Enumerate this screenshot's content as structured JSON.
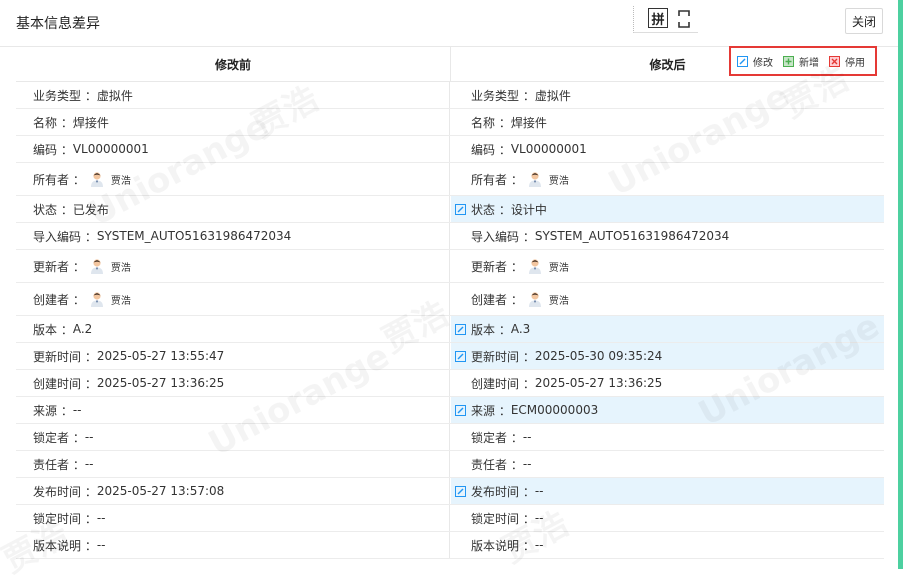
{
  "header": {
    "title": "基本信息差异",
    "pin_label": "拼",
    "close_label": "关闭"
  },
  "columns": {
    "before": "修改前",
    "after": "修改后"
  },
  "legend": [
    {
      "label": "修改",
      "color": "#2196f3"
    },
    {
      "label": "新增",
      "color": "#4caf50"
    },
    {
      "label": "停用",
      "color": "#e53935"
    }
  ],
  "watermark": {
    "brand": "Uniorange",
    "name": "贾浩"
  },
  "rows": [
    {
      "label": "业务类型",
      "before": "虚拟件",
      "after": "虚拟件",
      "changed": false
    },
    {
      "label": "名称",
      "before": "焊接件",
      "after": "焊接件",
      "changed": false
    },
    {
      "label": "编码",
      "before": "VL00000001",
      "after": "VL00000001",
      "changed": false
    },
    {
      "label": "所有者",
      "before_user": "贾浩",
      "after_user": "贾浩",
      "changed": false,
      "user": true
    },
    {
      "label": "状态",
      "before": "已发布",
      "after": "设计中",
      "changed": true
    },
    {
      "label": "导入编码",
      "before": "SYSTEM_AUTO51631986472034",
      "after": "SYSTEM_AUTO51631986472034",
      "changed": false
    },
    {
      "label": "更新者",
      "before_user": "贾浩",
      "after_user": "贾浩",
      "changed": false,
      "user": true
    },
    {
      "label": "创建者",
      "before_user": "贾浩",
      "after_user": "贾浩",
      "changed": false,
      "user": true
    },
    {
      "label": "版本",
      "before": "A.2",
      "after": "A.3",
      "changed": true
    },
    {
      "label": "更新时间",
      "before": "2025-05-27 13:55:47",
      "after": "2025-05-30 09:35:24",
      "changed": true
    },
    {
      "label": "创建时间",
      "before": "2025-05-27 13:36:25",
      "after": "2025-05-27 13:36:25",
      "changed": false
    },
    {
      "label": "来源",
      "before": "--",
      "after": "ECM00000003",
      "changed": true
    },
    {
      "label": "锁定者",
      "before": "--",
      "after": "--",
      "changed": false
    },
    {
      "label": "责任者",
      "before": "--",
      "after": "--",
      "changed": false
    },
    {
      "label": "发布时间",
      "before": "2025-05-27 13:57:08",
      "after": "--",
      "changed": true
    },
    {
      "label": "锁定时间",
      "before": "--",
      "after": "--",
      "changed": false
    },
    {
      "label": "版本说明",
      "before": "--",
      "after": "--",
      "changed": false
    }
  ]
}
